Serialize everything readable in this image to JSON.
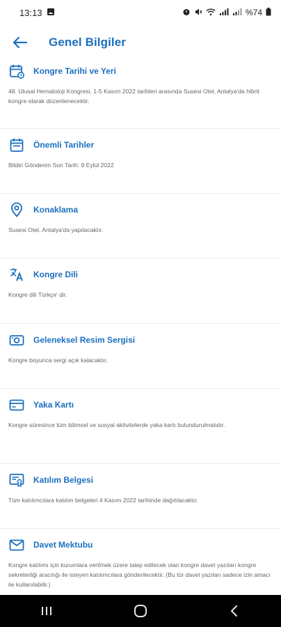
{
  "status_bar": {
    "time": "13:13",
    "battery": "%74"
  },
  "header": {
    "title": "Genel Bilgiler"
  },
  "sections": [
    {
      "icon": "calendar-clock-icon",
      "title": "Kongre Tarihi ve Yeri",
      "text": "48. Ulusal Hematoloji Kongresi, 1-5 Kasım 2022 tarihleri arasında Susesi Otel, Antalya'da hibrit kongre olarak düzenlenecektir."
    },
    {
      "icon": "calendar-icon",
      "title": "Önemli Tarihler",
      "text": "Bildiri Gönderim Son Tarih: 9 Eylül 2022"
    },
    {
      "icon": "location-pin-icon",
      "title": "Konaklama",
      "text": "Susesi Otel, Antalya'da yapılacaktır."
    },
    {
      "icon": "translate-icon",
      "title": "Kongre Dili",
      "text": "Kongre dili Türkçe' dir."
    },
    {
      "icon": "camera-icon",
      "title": "Geleneksel Resim Sergisi",
      "text": "Kongre boyunca sergi açık kalacaktır."
    },
    {
      "icon": "badge-card-icon",
      "title": "Yaka Kartı",
      "text": "Kongre süresince tüm bilimsel ve sosyal aktivitelerde yaka kartı bulundurulmalıdır."
    },
    {
      "icon": "certificate-icon",
      "title": "Katılım Belgesi",
      "text": "Tüm katılımcılara katılım belgeleri 4 Kasım 2022 tarihinde dağıtılacaktır."
    },
    {
      "icon": "mail-icon",
      "title": "Davet Mektubu",
      "text": "Kongre katılımı için kurumlara verilmek üzere talep edilecek olan kongre davet yazıları kongre sekreterliği aracılığı ile isteyen katılımcılara gönderilecektir. (Bu tür davet yazıları sadece izin amacı ile kullanılabilir.)"
    }
  ],
  "colors": {
    "accent": "#1a6fbf",
    "text_muted": "#666666",
    "divider": "#ececec",
    "nav_bg": "#000000"
  }
}
